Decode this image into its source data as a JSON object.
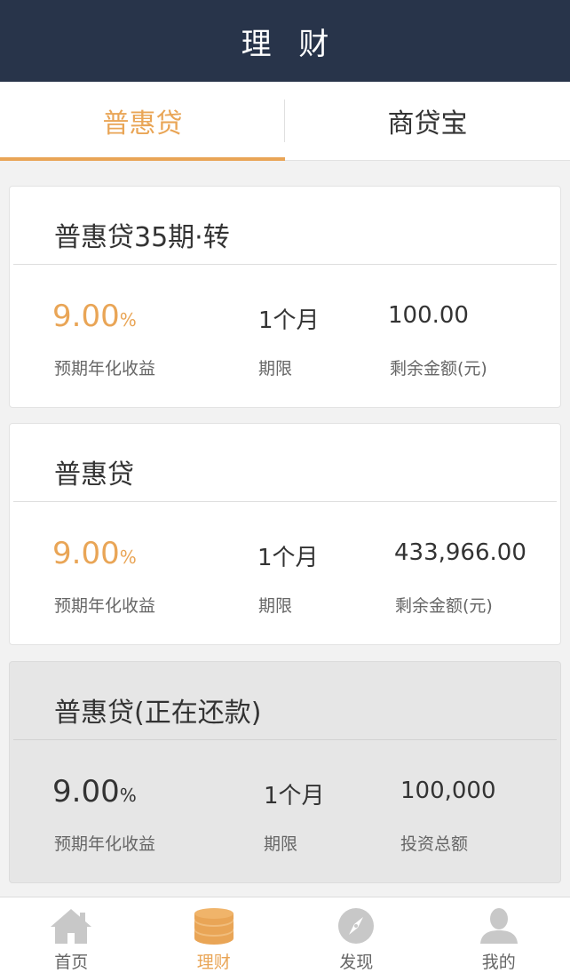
{
  "header": {
    "title": "理 财"
  },
  "tabs": [
    {
      "label": "普惠贷",
      "active": true
    },
    {
      "label": "商贷宝",
      "active": false
    }
  ],
  "products": [
    {
      "title": "普惠贷35期·转",
      "rate": "9.00",
      "rate_unit": "%",
      "rate_label": "预期年化收益",
      "term": "1个月",
      "term_label": "期限",
      "amount": "100.00",
      "amount_label": "剩余金额(元)",
      "status": "open"
    },
    {
      "title": "普惠贷",
      "rate": "9.00",
      "rate_unit": "%",
      "rate_label": "预期年化收益",
      "term": "1个月",
      "term_label": "期限",
      "amount": "433,966.00",
      "amount_label": "剩余金额(元)",
      "status": "open"
    },
    {
      "title": "普惠贷(正在还款)",
      "rate": "9.00",
      "rate_unit": "%",
      "rate_label": "预期年化收益",
      "term": "1个月",
      "term_label": "期限",
      "amount": "100,000",
      "amount_label": "投资总额",
      "status": "repaying"
    }
  ],
  "nav": [
    {
      "label": "首页",
      "icon": "home-icon",
      "active": false
    },
    {
      "label": "理财",
      "icon": "coins-icon",
      "active": true
    },
    {
      "label": "发现",
      "icon": "compass-icon",
      "active": false
    },
    {
      "label": "我的",
      "icon": "user-icon",
      "active": false
    }
  ],
  "colors": {
    "header_bg": "#28344a",
    "accent": "#e9a556",
    "icon_gray": "#c8c8c8"
  }
}
